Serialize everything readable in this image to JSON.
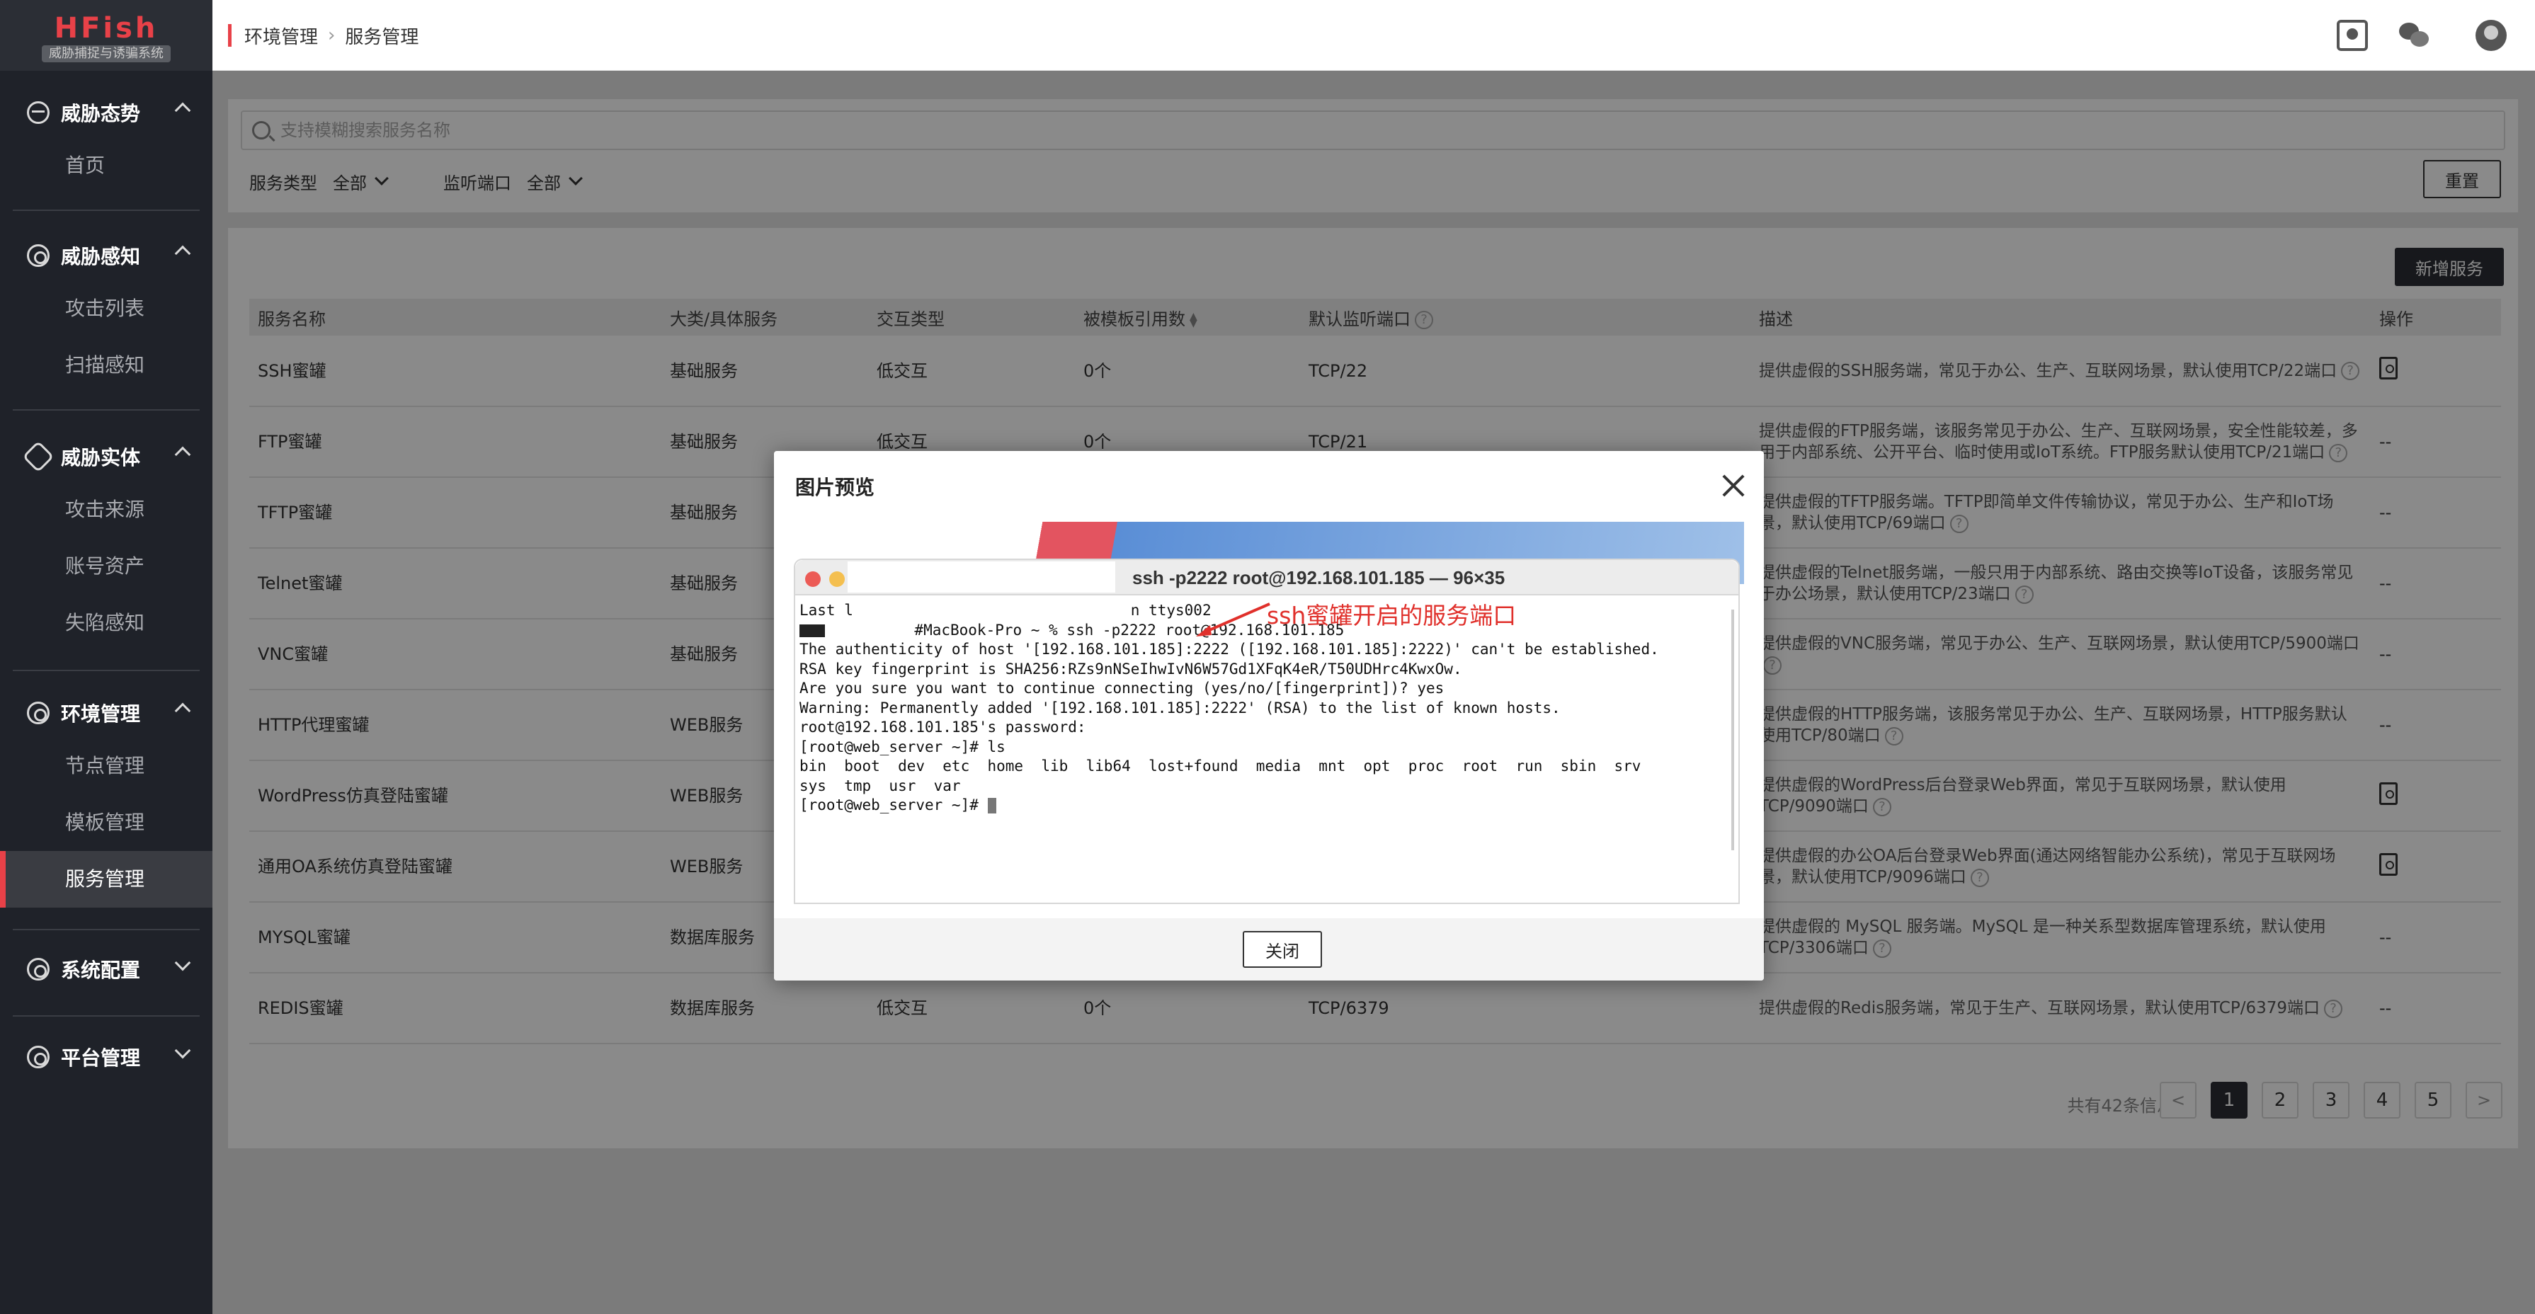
{
  "logo": {
    "name": "HFish",
    "subtitle": "威胁捕捉与诱骗系统"
  },
  "sidebar": {
    "groups": [
      {
        "label": "威胁态势",
        "icon": "pulse-icon",
        "items": [
          "首页"
        ]
      },
      {
        "label": "威胁感知",
        "icon": "radar-icon",
        "items": [
          "攻击列表",
          "扫描感知"
        ]
      },
      {
        "label": "威胁实体",
        "icon": "entity-icon",
        "items": [
          "攻击来源",
          "账号资产",
          "失陷感知"
        ]
      },
      {
        "label": "环境管理",
        "icon": "environment-icon",
        "items": [
          "节点管理",
          "模板管理",
          "服务管理"
        ]
      },
      {
        "label": "系统配置",
        "icon": "settings-icon",
        "items": []
      },
      {
        "label": "平台管理",
        "icon": "platform-icon",
        "items": []
      }
    ],
    "active_item": "服务管理"
  },
  "header": {
    "breadcrumb": [
      "环境管理",
      "服务管理"
    ],
    "icons": [
      "docs-icon",
      "wechat-icon",
      "user-avatar-icon"
    ]
  },
  "filters": {
    "search_placeholder": "支持模糊搜索服务名称",
    "service_type_label": "服务类型",
    "service_type_value": "全部",
    "port_label": "监听端口",
    "port_value": "全部",
    "reset_label": "重置"
  },
  "toolbar": {
    "add_label": "新增服务"
  },
  "table": {
    "columns": [
      "服务名称",
      "大类/具体服务",
      "交互类型",
      "被模板引用数",
      "默认监听端口",
      "描述",
      "操作"
    ],
    "rows": [
      {
        "name": "SSH蜜罐",
        "category": "基础服务",
        "interaction": "低交互",
        "refs": "0个",
        "port": "TCP/22",
        "desc": "提供虚假的SSH服务端，常见于办公、生产、互联网场景，默认使用TCP/22端口",
        "action": "doc"
      },
      {
        "name": "FTP蜜罐",
        "category": "基础服务",
        "interaction": "低交互",
        "refs": "0个",
        "port": "TCP/21",
        "desc": "提供虚假的FTP服务端，该服务常见于办公、生产、互联网场景，安全性能较差，多用于内部系统、公开平台、临时使用或IoT系统。FTP服务默认使用TCP/21端口",
        "action": "--"
      },
      {
        "name": "TFTP蜜罐",
        "category": "基础服务",
        "interaction": "",
        "refs": "",
        "port": "",
        "desc": "提供虚假的TFTP服务端。TFTP即简单文件传输协议，常见于办公、生产和IoT场景，默认使用TCP/69端口",
        "action": "--"
      },
      {
        "name": "Telnet蜜罐",
        "category": "基础服务",
        "interaction": "",
        "refs": "",
        "port": "",
        "desc": "提供虚假的Telnet服务端，一般只用于内部系统、路由交换等IoT设备，该服务常见于办公场景，默认使用TCP/23端口",
        "action": "--"
      },
      {
        "name": "VNC蜜罐",
        "category": "基础服务",
        "interaction": "",
        "refs": "",
        "port": "",
        "desc": "提供虚假的VNC服务端，常见于办公、生产、互联网场景，默认使用TCP/5900端口",
        "action": "--"
      },
      {
        "name": "HTTP代理蜜罐",
        "category": "WEB服务",
        "interaction": "",
        "refs": "",
        "port": "",
        "desc": "提供虚假的HTTP服务端，该服务常见于办公、生产、互联网场景，HTTP服务默认使用TCP/80端口",
        "action": "--"
      },
      {
        "name": "WordPress仿真登陆蜜罐",
        "category": "WEB服务",
        "interaction": "",
        "refs": "",
        "port": "",
        "desc": "提供虚假的WordPress后台登录Web界面，常见于互联网场景，默认使用TCP/9090端口",
        "action": "doc"
      },
      {
        "name": "通用OA系统仿真登陆蜜罐",
        "category": "WEB服务",
        "interaction": "",
        "refs": "",
        "port": "",
        "desc": "提供虚假的办公OA后台登录Web界面(通达网络智能办公系统)，常见于互联网场景，默认使用TCP/9096端口",
        "action": "doc"
      },
      {
        "name": "MYSQL蜜罐",
        "category": "数据库服务",
        "interaction": "",
        "refs": "",
        "port": "",
        "desc": "提供虚假的 MySQL 服务端。MySQL 是一种关系型数据库管理系统，默认使用TCP/3306端口",
        "action": "--"
      },
      {
        "name": "REDIS蜜罐",
        "category": "数据库服务",
        "interaction": "低交互",
        "refs": "0个",
        "port": "TCP/6379",
        "desc": "提供虚假的Redis服务端，常见于生产、互联网场景，默认使用TCP/6379端口",
        "action": "--"
      }
    ]
  },
  "pagination": {
    "total_text": "共有42条信息",
    "prev": "<",
    "next": ">",
    "pages": [
      "1",
      "2",
      "3",
      "4",
      "5"
    ],
    "current": "1"
  },
  "modal": {
    "title": "图片预览",
    "close_label": "关闭",
    "terminal": {
      "title": "ssh -p2222 root@192.168.101.185 — 96×35",
      "annotation": "ssh蜜罐开启的服务端口",
      "lines": [
        "Last l                               n ttys002",
        "          #MacBook-Pro ~ % ssh -p2222 root@192.168.101.185",
        "The authenticity of host '[192.168.101.185]:2222 ([192.168.101.185]:2222)' can't be established.",
        "RSA key fingerprint is SHA256:RZs9nNSeIhwIvN6W57Gd1XFqK4eR/T50UDHrc4KwxOw.",
        "Are you sure you want to continue connecting (yes/no/[fingerprint])? yes",
        "Warning: Permanently added '[192.168.101.185]:2222' (RSA) to the list of known hosts.",
        "root@192.168.101.185's password:",
        "[root@web_server ~]# ls",
        "bin  boot  dev  etc  home  lib  lib64  lost+found  media  mnt  opt  proc  root  run  sbin  srv",
        "sys  tmp  usr  var",
        "[root@web_server ~]# "
      ]
    }
  },
  "colors": {
    "brand": "#e84148",
    "sidebar_bg": "#1f2229",
    "primary_button": "#2b2e35"
  }
}
